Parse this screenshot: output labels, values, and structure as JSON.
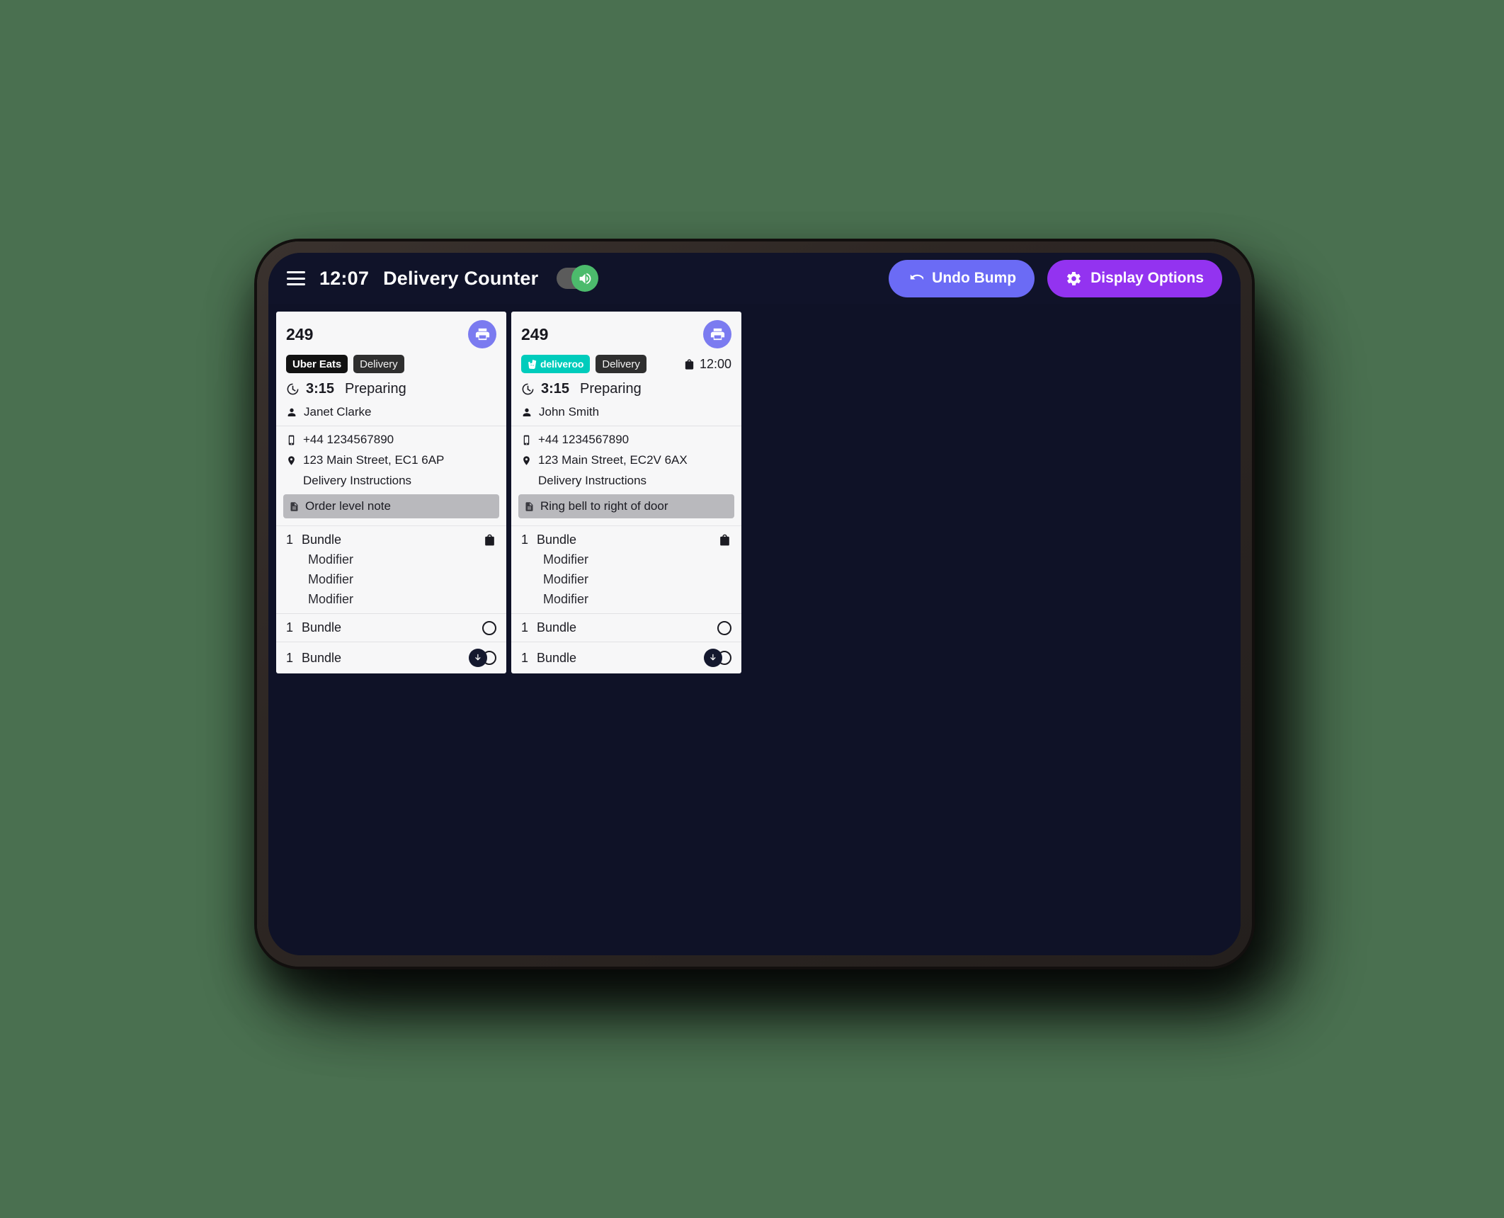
{
  "header": {
    "menu_icon": "hamburger-menu-icon",
    "clock": "12:07",
    "title": "Delivery Counter",
    "sound_toggle": {
      "state": "on",
      "icon": "speaker-on-icon"
    },
    "undo_bump_label": "Undo Bump",
    "undo_bump_icon": "undo-arrow-icon",
    "display_options_label": "Display Options",
    "display_options_icon": "gear-icon"
  },
  "colors": {
    "page_background": "#4a7050",
    "device_bezel": "#2e2724",
    "screen_background": "#0f1227",
    "header_background": "#101329",
    "undo_bump": "#6b6bf5",
    "display_options": "#9333f0",
    "print_button": "#7b7bf0",
    "deliveroo_teal": "#00ccbc",
    "ubereats_black": "#121212",
    "delivery_chip": "#2f2f2f",
    "note_background": "#b9b9bd",
    "card_background": "#f7f7f8",
    "toggle_knob_green": "#4cbb6c"
  },
  "orders": [
    {
      "order_number": "249",
      "print_icon": "printer-icon",
      "platform_badge": {
        "type": "ubereats",
        "label": "Uber Eats"
      },
      "order_type": "Delivery",
      "scheduled_time": null,
      "status_icon": "timer-icon",
      "elapsed_time": "3:15",
      "status": "Preparing",
      "customer_name": "Janet Clarke",
      "customer_icon": "person-icon",
      "phone": "+44 1234567890",
      "phone_icon": "phone-icon",
      "address": "123 Main Street, EC1 6AP",
      "address_icon": "location-pin-icon",
      "delivery_instructions_label": "Delivery Instructions",
      "note": "Order level note",
      "note_icon": "note-icon",
      "items": [
        {
          "qty": "1",
          "name": "Bundle",
          "icon": "shopping-bag-icon",
          "modifiers": [
            "Modifier",
            "Modifier",
            "Modifier"
          ]
        },
        {
          "qty": "1",
          "name": "Bundle",
          "icon": "circle-outline-icon",
          "modifiers": []
        },
        {
          "qty": "1",
          "name": "Bundle",
          "icon": "download-circle-icon",
          "modifiers": []
        }
      ]
    },
    {
      "order_number": "249",
      "print_icon": "printer-icon",
      "platform_badge": {
        "type": "deliveroo",
        "label": "deliveroo"
      },
      "order_type": "Delivery",
      "scheduled_time": "12:00",
      "scheduled_icon": "shopping-bag-icon",
      "status_icon": "timer-icon",
      "elapsed_time": "3:15",
      "status": "Preparing",
      "customer_name": "John Smith",
      "customer_icon": "person-icon",
      "phone": "+44 1234567890",
      "phone_icon": "phone-icon",
      "address": "123 Main Street, EC2V 6AX",
      "address_icon": "location-pin-icon",
      "delivery_instructions_label": "Delivery Instructions",
      "note": "Ring bell to right of door",
      "note_icon": "note-icon",
      "items": [
        {
          "qty": "1",
          "name": "Bundle",
          "icon": "shopping-bag-icon",
          "modifiers": [
            "Modifier",
            "Modifier",
            "Modifier"
          ]
        },
        {
          "qty": "1",
          "name": "Bundle",
          "icon": "circle-outline-icon",
          "modifiers": []
        },
        {
          "qty": "1",
          "name": "Bundle",
          "icon": "download-circle-icon",
          "modifiers": []
        }
      ]
    }
  ]
}
